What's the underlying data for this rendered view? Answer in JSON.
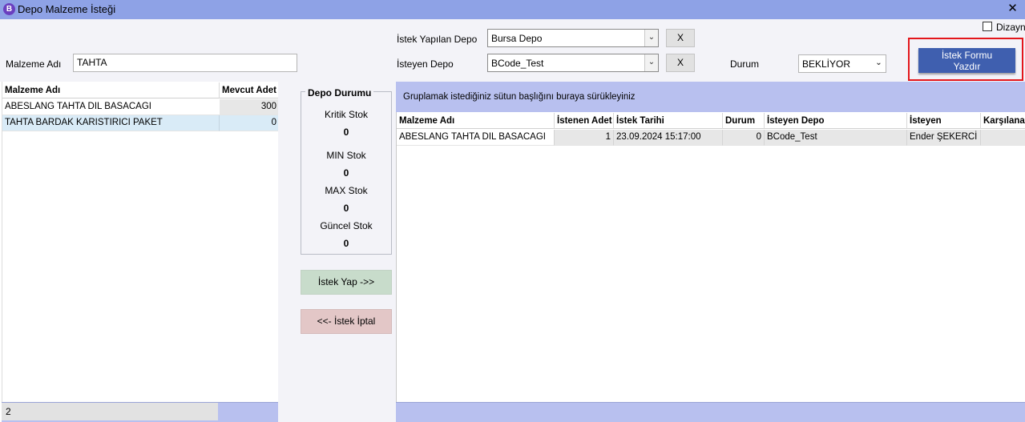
{
  "window": {
    "icon_letter": "B",
    "title": "Depo Malzeme İsteği",
    "close_glyph": "✕"
  },
  "form": {
    "malzeme_adi_label": "Malzeme Adı",
    "malzeme_adi_value": "TAHTA",
    "istek_yapilan_depo_label": "İstek Yapılan Depo",
    "istek_yapilan_depo_value": "Bursa Depo",
    "isteyen_depo_label": "İsteyen Depo",
    "isteyen_depo_value": "BCode_Test",
    "clear_label": "X",
    "durum_label": "Durum",
    "durum_value": "BEKLİYOR",
    "dizayn_label": "Dizayn",
    "dizayn_checked": false,
    "print_line1": "İstek Formu",
    "print_line2": "Yazdır",
    "combo_arrow": "⌄"
  },
  "left_grid": {
    "columns": [
      "Malzeme Adı",
      "Mevcut Adet"
    ],
    "rows": [
      {
        "name": "ABESLANG TAHTA DIL BASACAGI",
        "qty": "300"
      },
      {
        "name": "TAHTA BARDAK KARISTIRICI PAKET",
        "qty": "0"
      }
    ],
    "footer_count": "2"
  },
  "depo_durumu": {
    "title": "Depo Durumu",
    "kritik_label": "Kritik Stok",
    "kritik_value": "0",
    "min_label": "MIN Stok",
    "min_value": "0",
    "max_label": "MAX Stok",
    "max_value": "0",
    "guncel_label": "Güncel Stok",
    "guncel_value": "0"
  },
  "actions": {
    "istek_yap": "İstek Yap ->>",
    "istek_iptal": "<<- İstek İptal"
  },
  "right_grid": {
    "group_hint": "Gruplamak istediğiniz sütun başlığını buraya sürükleyiniz",
    "columns": [
      "Malzeme Adı",
      "İstenen Adet",
      "İstek Tarihi",
      "Durum",
      "İsteyen Depo",
      "İsteyen",
      "Karşılanan"
    ],
    "rows": [
      {
        "malzeme": "ABESLANG TAHTA DIL BASACAGI",
        "adet": "1",
        "tarih": "23.09.2024 15:17:00",
        "durum": "0",
        "depo": "BCode_Test",
        "isteyen": "Ender ŞEKERCİ",
        "karsilanan": ""
      }
    ]
  },
  "colors": {
    "titlebar": "#8ea2e6",
    "accent_band": "#b8c0ef",
    "print_button": "#3f5faf",
    "highlight_outline": "#e3161b",
    "selected_row": "#d9ebf7"
  }
}
